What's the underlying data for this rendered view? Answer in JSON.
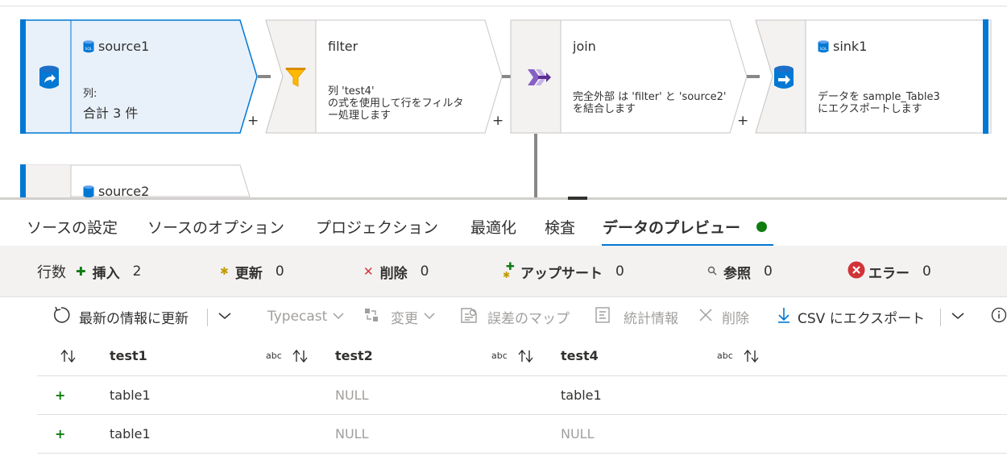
{
  "flow": {
    "source1": {
      "title": "source1",
      "desc_label": "列:",
      "desc_value": "合計 3 件"
    },
    "filter": {
      "title": "filter",
      "desc": "列 'test4'\nの式を使用して行をフィルタ\nー処理します"
    },
    "join": {
      "title": "join",
      "desc": "完全外部 は 'filter' と 'source2'\nを結合します"
    },
    "sink1": {
      "title": "sink1",
      "desc": "データを sample_Table3\nにエクスポートします"
    },
    "source2": {
      "title": "source2"
    },
    "add_symbol": "+"
  },
  "tabs": [
    {
      "label": "ソースの設定"
    },
    {
      "label": "ソースのオプション"
    },
    {
      "label": "プロジェクション"
    },
    {
      "label": "最適化"
    },
    {
      "label": "検査"
    },
    {
      "label": "データのプレビュー"
    }
  ],
  "stats": {
    "rows_label": "行数",
    "insert": {
      "label": "挿入",
      "count": "2"
    },
    "update": {
      "label": "更新",
      "count": "0"
    },
    "delete": {
      "label": "削除",
      "count": "0"
    },
    "upsert": {
      "label": "アップサート",
      "count": "0"
    },
    "lookup": {
      "label": "参照",
      "count": "0"
    },
    "error": {
      "label": "エラー",
      "count": "0"
    }
  },
  "toolbar": {
    "refresh": "最新の情報に更新",
    "typecast": "Typecast",
    "modify": "変更",
    "error_map": "誤差のマップ",
    "statistics": "統計情報",
    "remove": "削除",
    "export_csv": "CSV にエクスポート"
  },
  "table": {
    "type_label": "abc",
    "columns": [
      "test1",
      "test2",
      "test4"
    ],
    "rows": [
      {
        "marker": "+",
        "cells": [
          "table1",
          "NULL",
          "table1"
        ]
      },
      {
        "marker": "+",
        "cells": [
          "table1",
          "NULL",
          "NULL"
        ]
      }
    ]
  },
  "colors": {
    "accent": "#0078d4",
    "selected_bg": "#e8f1fa",
    "success": "#107c10",
    "error": "#d13438",
    "disabled": "#a19f9d"
  }
}
